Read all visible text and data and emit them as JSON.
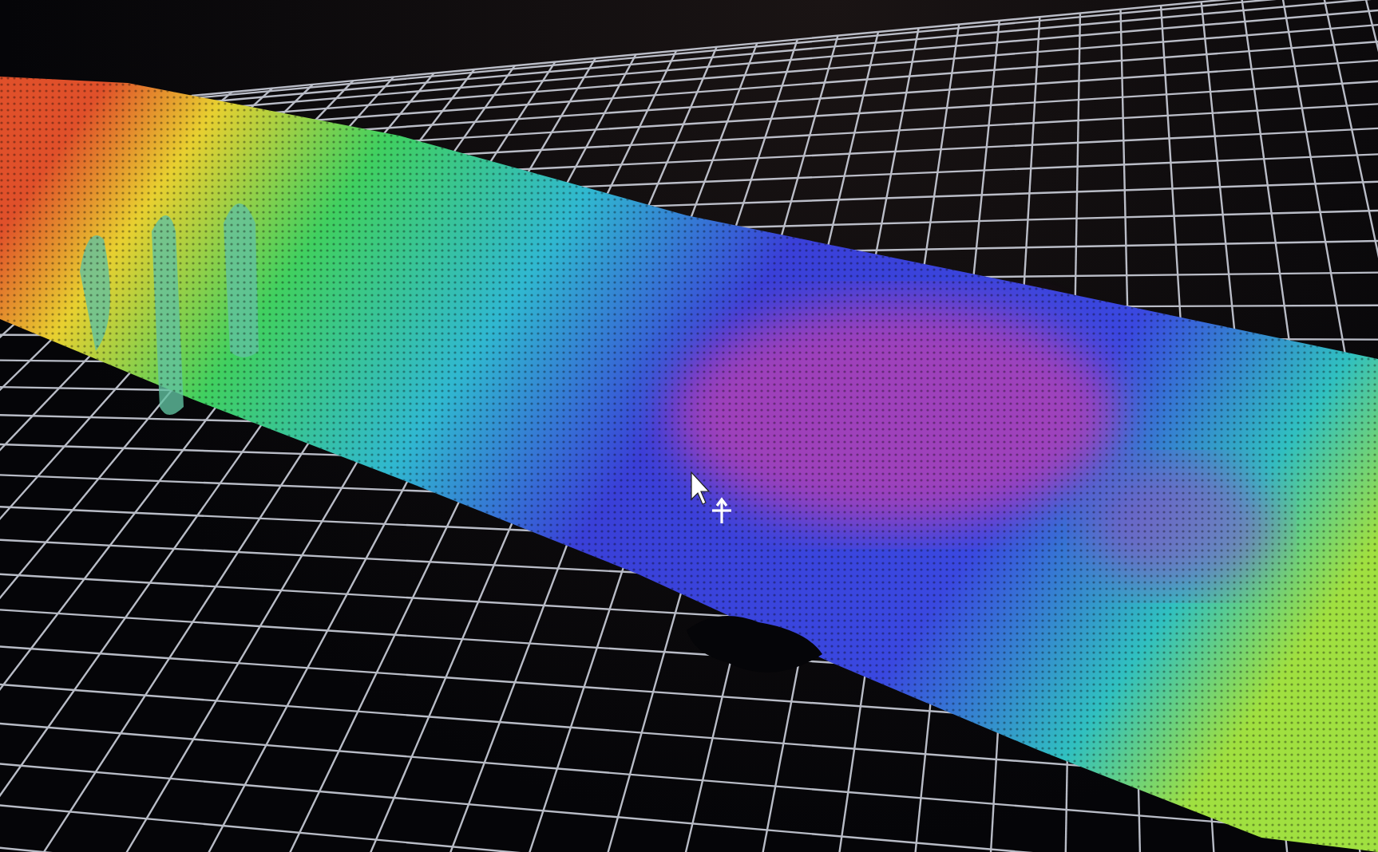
{
  "viewport": {
    "grid": true,
    "pointer": true,
    "move_handle": true
  }
}
